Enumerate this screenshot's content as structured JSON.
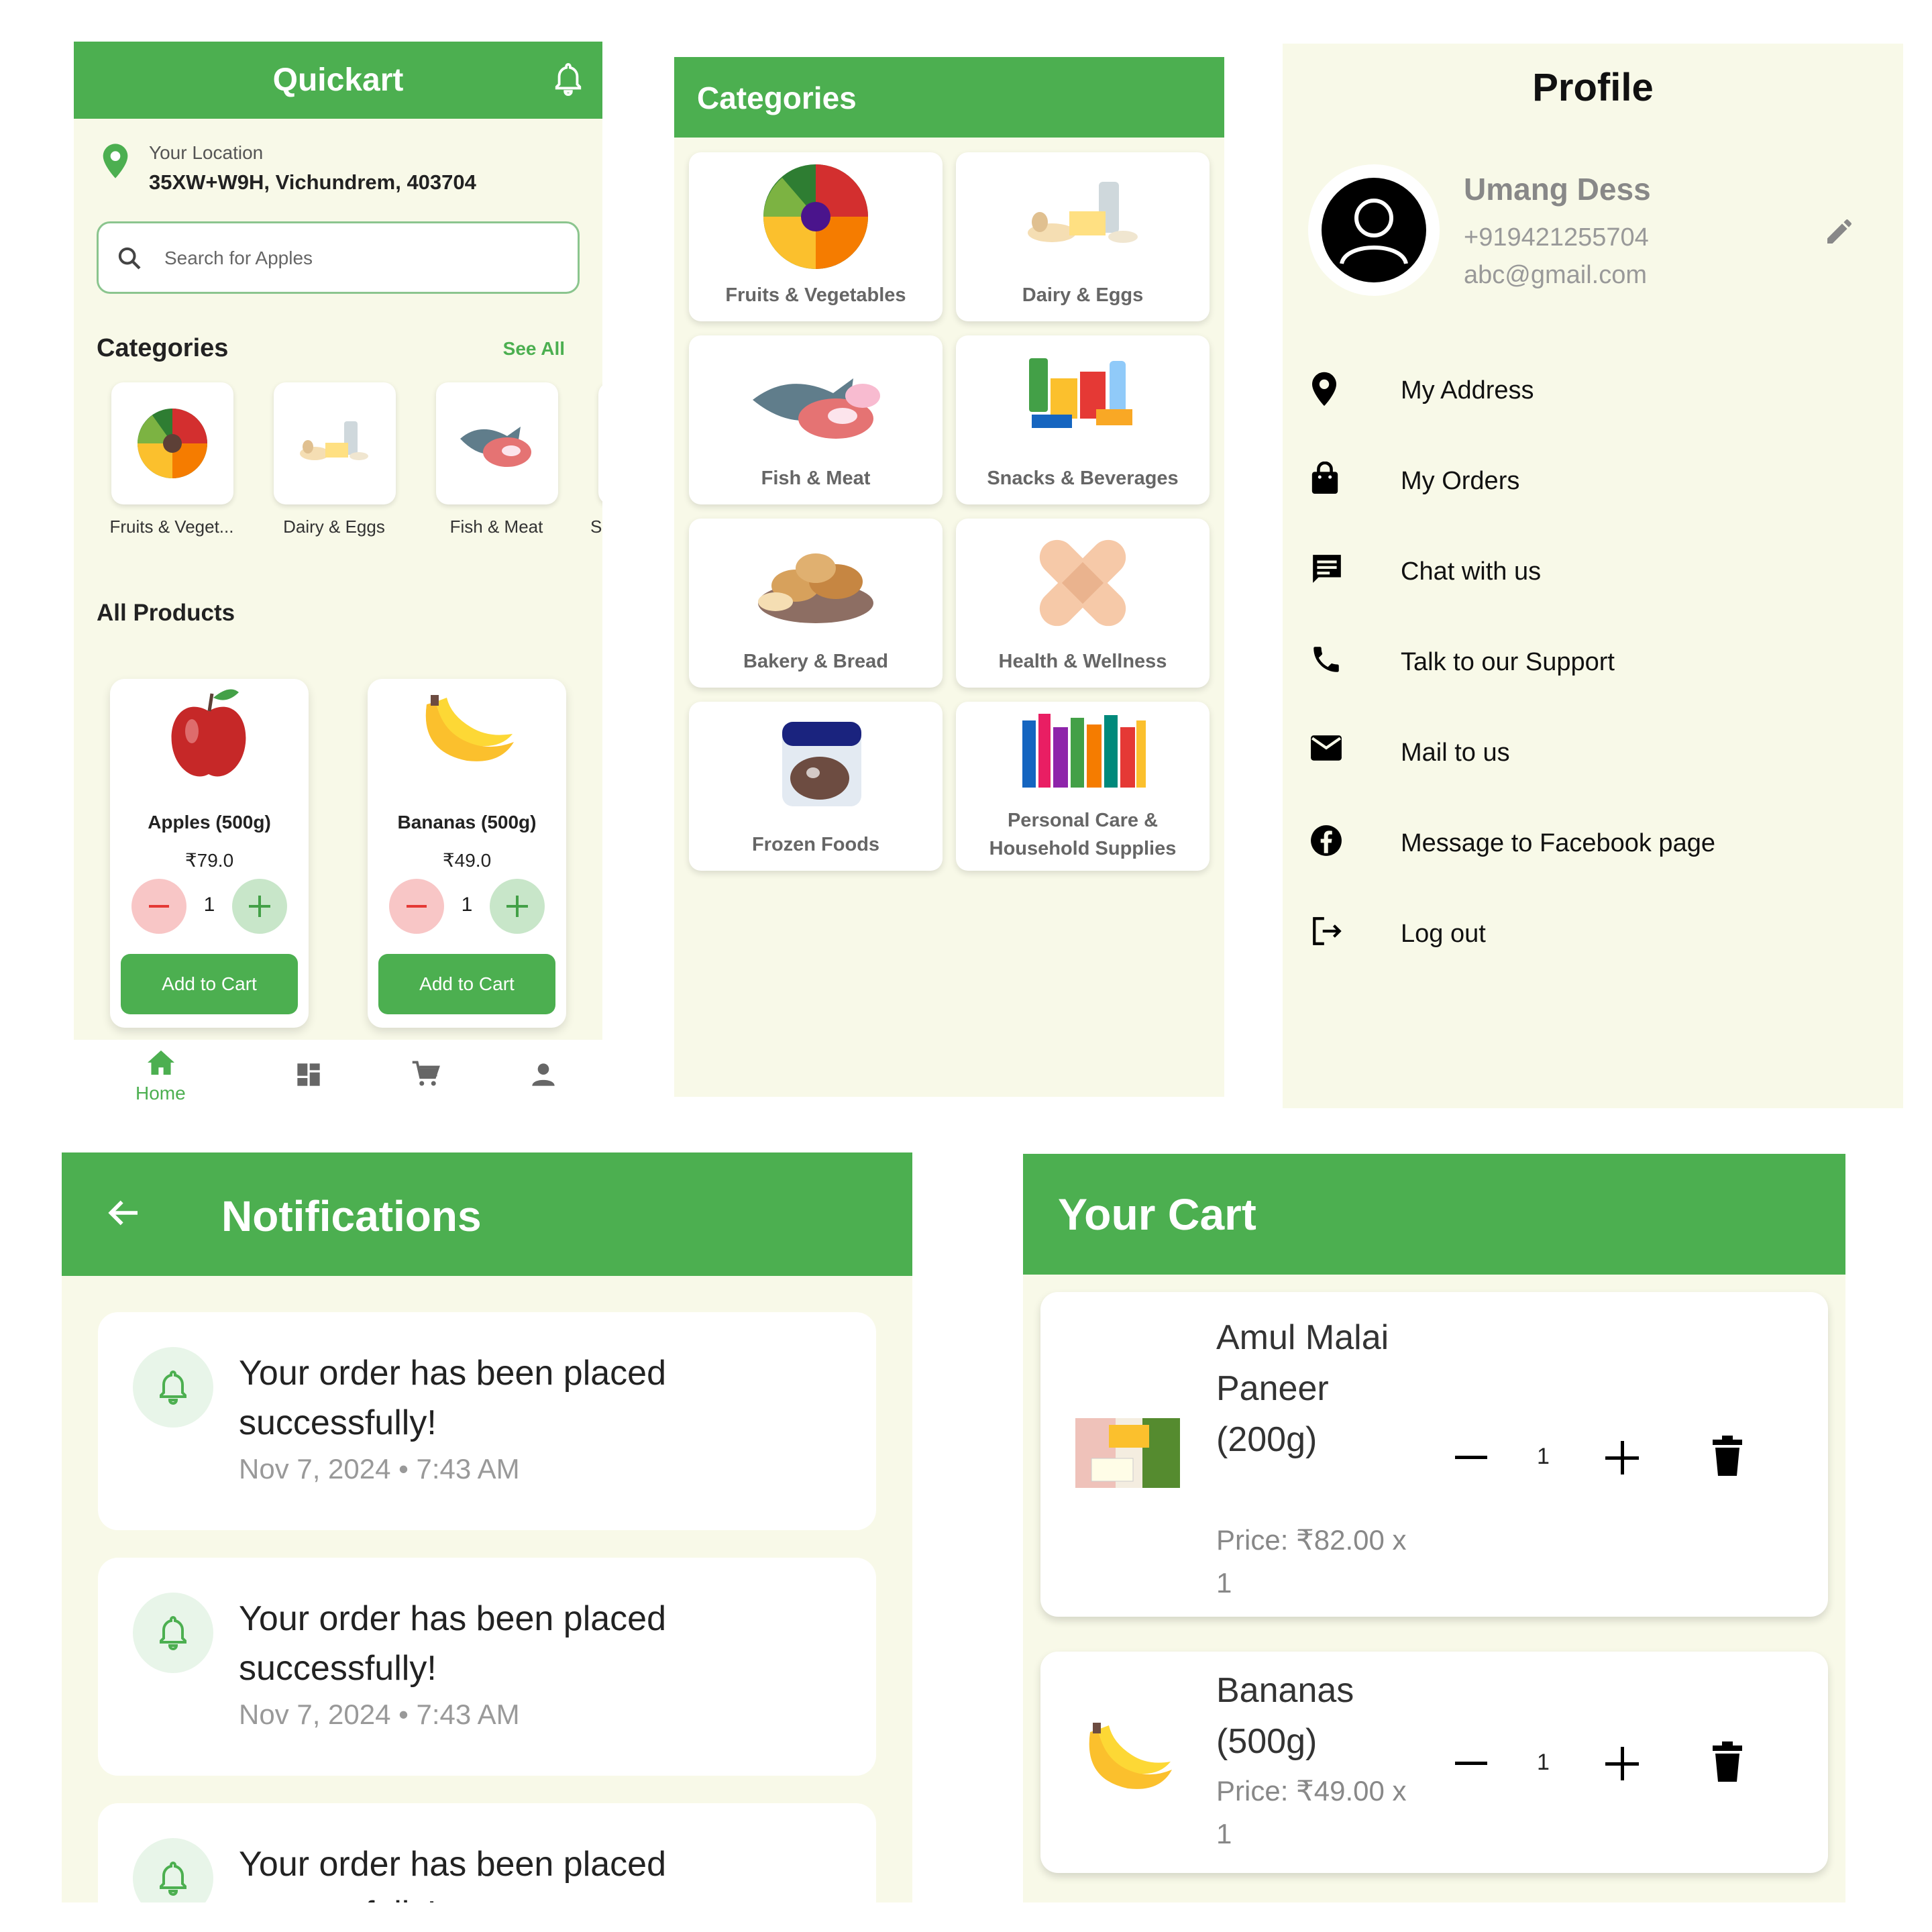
{
  "home": {
    "app_title": "Quickart",
    "location_label": "Your Location",
    "location_value": "35XW+W9H, Vichundrem, 403704",
    "search_placeholder": "Search for Apples",
    "categories_title": "Categories",
    "see_all": "See All",
    "categories": [
      "Fruits & Veget...",
      "Dairy & Eggs",
      "Fish & Meat",
      "S"
    ],
    "all_products_title": "All Products",
    "products": [
      {
        "name": "Apples (500g)",
        "price": "₹79.0",
        "qty": "1",
        "button": "Add to Cart"
      },
      {
        "name": "Bananas (500g)",
        "price": "₹49.0",
        "qty": "1",
        "button": "Add to Cart"
      }
    ],
    "nav": {
      "home_label": "Home"
    }
  },
  "categories_screen": {
    "title": "Categories",
    "items": [
      "Fruits & Vegetables",
      "Dairy & Eggs",
      "Fish & Meat",
      "Snacks & Beverages",
      "Bakery & Bread",
      "Health & Wellness",
      "Frozen Foods",
      "Personal Care & Household Supplies"
    ]
  },
  "profile": {
    "title": "Profile",
    "name": "Umang Dess",
    "phone": "+919421255704",
    "email": "abc@gmail.com",
    "menu": [
      "My Address",
      "My Orders",
      "Chat with us",
      "Talk to our Support",
      "Mail to us",
      "Message to Facebook page",
      "Log out"
    ]
  },
  "notifications": {
    "title": "Notifications",
    "items": [
      {
        "text": "Your order has been placed successfully!",
        "time": "Nov 7, 2024 • 7:43 AM"
      },
      {
        "text": "Your order has been placed successfully!",
        "time": "Nov 7, 2024 • 7:43 AM"
      },
      {
        "text": "Your order has been placed successfully!",
        "time": ""
      }
    ]
  },
  "cart": {
    "title": "Your Cart",
    "items": [
      {
        "name": "Amul Malai Paneer (200g)",
        "price": "Price: ₹82.00 x 1",
        "qty": "1"
      },
      {
        "name": "Bananas (500g)",
        "price": "Price: ₹49.00 x 1",
        "qty": "1"
      }
    ]
  },
  "colors": {
    "primary": "#4caf50",
    "background": "#f8f9e8",
    "minus": "#f8c6c6",
    "plus": "#c8e6c9"
  }
}
